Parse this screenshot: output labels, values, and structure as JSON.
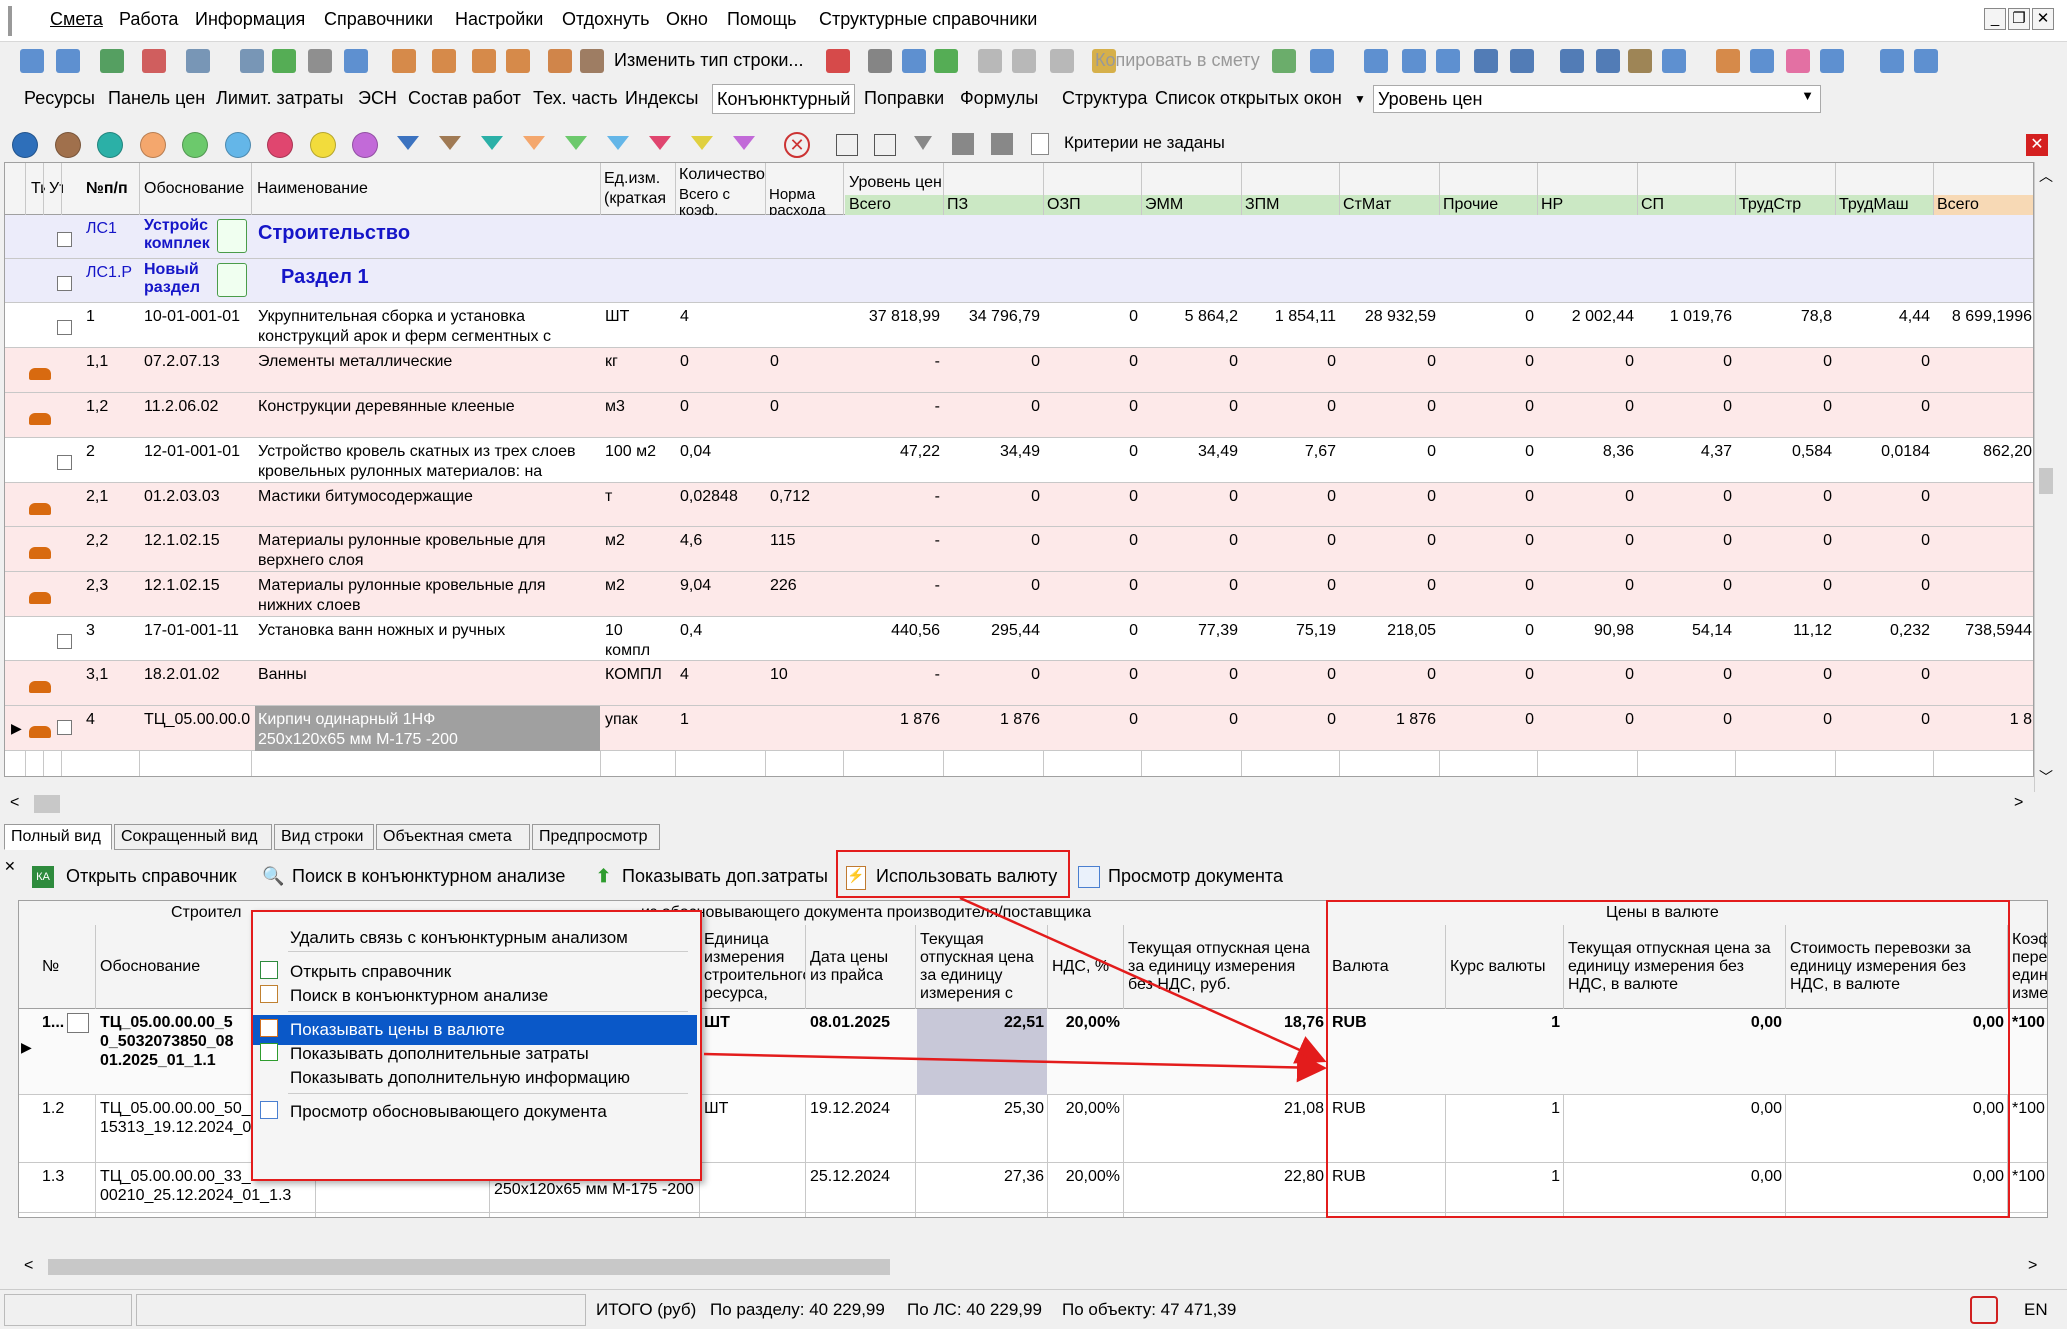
{
  "menu": [
    "Смета",
    "Работа",
    "Информация",
    "Справочники",
    "Настройки",
    "Отдохнуть",
    "Окно",
    "Помощь",
    "Структурные справочники"
  ],
  "toolbar1": {
    "change_type": "Изменить тип строки...",
    "copy_to_estimate": "Копировать в смету"
  },
  "tabs": [
    "Ресурсы",
    "Панель цен",
    "Лимит. затраты",
    "ЭСН",
    "Состав работ",
    "Тех. часть",
    "Индексы",
    "Конъюнктурный",
    "Поправки",
    "Формулы",
    "Структура",
    "Список открытых окон"
  ],
  "price_level_label": "Уровень цен",
  "filter_text": "Критерии не заданы",
  "colors": {
    "circles": [
      "#2e6fba",
      "#a0704c",
      "#2bb0a7",
      "#f4a76d",
      "#6cc96c",
      "#64b6e8",
      "#e0466f",
      "#f2dc3c",
      "#c26ad8"
    ],
    "funnels": [
      "#3c73c0",
      "#a07a54",
      "#2bb0a7",
      "#f4a76d",
      "#6cc96c",
      "#64b6e8",
      "#e0466f",
      "#e0d040",
      "#c26ad8"
    ],
    "accent_red": "#e31c1c",
    "pink_row": "#fde9e9",
    "blue_row": "#ececfa",
    "green_header": "#cbe8c4",
    "orange_header": "#f7d9b5"
  },
  "grid": {
    "headers": {
      "ti": "Ти",
      "ut": "Ут",
      "npp": "№п/п",
      "basis": "Обоснование",
      "name": "Наименование",
      "unit": "Ед.изм. (краткая",
      "qty_group": "Количество",
      "qty_total": "Всего с коэф.",
      "qty_norm": "Норма расхода",
      "price_level": "Уровень цен"
    },
    "subheaders": [
      "Всего",
      "ПЗ",
      "ОЗП",
      "ЭММ",
      "ЗПМ",
      "СтМат",
      "Прочие",
      "НР",
      "СП",
      "ТрудСтр",
      "ТрудМаш",
      "Всего"
    ],
    "rows": [
      {
        "type": "section",
        "npp": "ЛС1",
        "basis": "Устройс\nкомплек",
        "name": "Строительство"
      },
      {
        "type": "section",
        "npp": "ЛС1.Р",
        "basis": "Новый\nраздел",
        "name": "Раздел 1"
      },
      {
        "type": "work",
        "npp": "1",
        "basis": "10-01-001-01",
        "name": "Укрупнительная сборка и установка\nконструкций арок и ферм сегментных с",
        "unit": "ШТ",
        "qty": "4",
        "norm": "",
        "v": [
          "37 818,99",
          "34 796,79",
          "0",
          "5 864,2",
          "1 854,11",
          "28 932,59",
          "0",
          "2 002,44",
          "1 019,76",
          "78,8",
          "4,44",
          "8 699,1996"
        ]
      },
      {
        "type": "res",
        "npp": "1,1",
        "basis": "07.2.07.13",
        "name": "Элементы металлические",
        "unit": "кг",
        "qty": "0",
        "norm": "0",
        "v": [
          "-",
          "0",
          "0",
          "0",
          "0",
          "0",
          "0",
          "0",
          "0",
          "0",
          "0",
          ""
        ]
      },
      {
        "type": "res",
        "npp": "1,2",
        "basis": "11.2.06.02",
        "name": "Конструкции деревянные клееные",
        "unit": "м3",
        "qty": "0",
        "norm": "0",
        "v": [
          "-",
          "0",
          "0",
          "0",
          "0",
          "0",
          "0",
          "0",
          "0",
          "0",
          "0",
          ""
        ]
      },
      {
        "type": "work",
        "npp": "2",
        "basis": "12-01-001-01",
        "name": "Устройство кровель скатных из трех слоев\nкровельных рулонных материалов: на",
        "unit": "100 м2",
        "qty": "0,04",
        "norm": "",
        "v": [
          "47,22",
          "34,49",
          "0",
          "34,49",
          "7,67",
          "0",
          "0",
          "8,36",
          "4,37",
          "0,584",
          "0,0184",
          "862,20"
        ]
      },
      {
        "type": "res",
        "npp": "2,1",
        "basis": "01.2.03.03",
        "name": "Мастики битумосодержащие",
        "unit": "т",
        "qty": "0,02848",
        "norm": "0,712",
        "v": [
          "-",
          "0",
          "0",
          "0",
          "0",
          "0",
          "0",
          "0",
          "0",
          "0",
          "0",
          ""
        ]
      },
      {
        "type": "res",
        "npp": "2,2",
        "basis": "12.1.02.15",
        "name": "Материалы рулонные кровельные для\nверхнего слоя",
        "unit": "м2",
        "qty": "4,6",
        "norm": "115",
        "v": [
          "-",
          "0",
          "0",
          "0",
          "0",
          "0",
          "0",
          "0",
          "0",
          "0",
          "0",
          ""
        ]
      },
      {
        "type": "res",
        "npp": "2,3",
        "basis": "12.1.02.15",
        "name": "Материалы рулонные кровельные для\nнижних слоев",
        "unit": "м2",
        "qty": "9,04",
        "norm": "226",
        "v": [
          "-",
          "0",
          "0",
          "0",
          "0",
          "0",
          "0",
          "0",
          "0",
          "0",
          "0",
          ""
        ]
      },
      {
        "type": "work",
        "npp": "3",
        "basis": "17-01-001-11",
        "name": "Установка ванн ножных и ручных",
        "unit": "10\nкомпл",
        "qty": "0,4",
        "norm": "",
        "v": [
          "440,56",
          "295,44",
          "0",
          "77,39",
          "75,19",
          "218,05",
          "0",
          "90,98",
          "54,14",
          "11,12",
          "0,232",
          "738,5944"
        ]
      },
      {
        "type": "res",
        "npp": "3,1",
        "basis": "18.2.01.02",
        "name": "Ванны",
        "unit": "КОМПЛ",
        "qty": "4",
        "norm": "10",
        "v": [
          "-",
          "0",
          "0",
          "0",
          "0",
          "0",
          "0",
          "0",
          "0",
          "0",
          "0",
          ""
        ]
      },
      {
        "type": "sel",
        "npp": "4",
        "basis": "ТЦ_05.00.00.0",
        "name": "Кирпич одинарный 1НФ\n250x120x65 мм М-175 -200",
        "unit": "упак",
        "qty": "1",
        "norm": "",
        "v": [
          "1 876",
          "1 876",
          "0",
          "0",
          "0",
          "1 876",
          "0",
          "0",
          "0",
          "0",
          "0",
          "1 8"
        ]
      }
    ]
  },
  "bottom_tabs": [
    "Полный вид",
    "Сокращенный вид",
    "Вид строки",
    "Объектная смета",
    "Предпросмотр"
  ],
  "lower_toolbar": {
    "open_ref": "Открыть справочник",
    "search_market": "Поиск в конъюнктурном анализе",
    "show_extra": "Показывать доп.затраты",
    "use_currency": "Использовать валюту",
    "view_doc": "Просмотр документа"
  },
  "lower_grid": {
    "group_left": "Строител",
    "group_mid": "из обосновывающего документа производителя/поставщика",
    "group_currency": "Цены в валюте",
    "headers": {
      "no": "№",
      "basis": "Обоснование",
      "unit": "Единица\nизмерения\nстроительного\nресурса,",
      "date": "Дата цены\nиз прайса",
      "cur_price": "Текущая\nотпускная цена\nза единицу\nизмерения с",
      "vat": "НДС, %",
      "price_novat": "Текущая отпускная цена\nза единицу измерения\nбез НДС, руб.",
      "currency": "Валюта",
      "rate": "Курс валюты",
      "price_cur": "Текущая отпускная цена за\nединицу измерения без\nНДС, в валюте",
      "transport_cur": "Стоимость перевозки за\nединицу измерения без\nНДС, в валюте",
      "coef": "Коэфф\nпересч\nединиц\nизмер"
    },
    "rows": [
      {
        "no": "1...",
        "basis": "ТЦ_05.00.00.00_5\n0_5032073850_08\n01.2025_01_1.1",
        "unit": "ШТ",
        "date": "08.01.2025",
        "cur_price": "22,51",
        "vat": "20,00%",
        "price_novat": "18,76",
        "currency": "RUB",
        "rate": "1",
        "price_cur": "0,00",
        "transport_cur": "0,00",
        "coef": "*100"
      },
      {
        "no": "1.2",
        "basis": "ТЦ_05.00.00.00_50_\n15313_19.12.2024_0",
        "unit": "ШТ",
        "date": "19.12.2024",
        "cur_price": "25,30",
        "vat": "20,00%",
        "price_novat": "21,08",
        "currency": "RUB",
        "rate": "1",
        "price_cur": "0,00",
        "transport_cur": "0,00",
        "coef": "*100"
      },
      {
        "no": "1.3",
        "basis": "ТЦ_05.00.00.00_33_00.00\n00210_25.12.2024_01_1.3",
        "unit": "",
        "name": "Кирпич одинарный 1НФ\n250x120x65 мм М-175 -200",
        "date": "25.12.2024",
        "cur_price": "27,36",
        "vat": "20,00%",
        "price_novat": "22,80",
        "currency": "RUB",
        "rate": "1",
        "price_cur": "0,00",
        "transport_cur": "0,00",
        "coef": "*100"
      }
    ]
  },
  "context_menu": [
    "Удалить связь с конъюнктурным анализом",
    "Открыть справочник",
    "Поиск в конъюнктурном анализе",
    "Показывать цены в валюте",
    "Показывать дополнительные затраты",
    "Показывать дополнительную информацию",
    "Просмотр обосновывающего документа"
  ],
  "status": {
    "itogo": "ИТОГО (руб)",
    "po_razdelu": "По разделу: 40 229,99",
    "po_ls": "По ЛС: 40 229,99",
    "po_obj": "По объекту: 47 471,39",
    "lang": "EN"
  }
}
